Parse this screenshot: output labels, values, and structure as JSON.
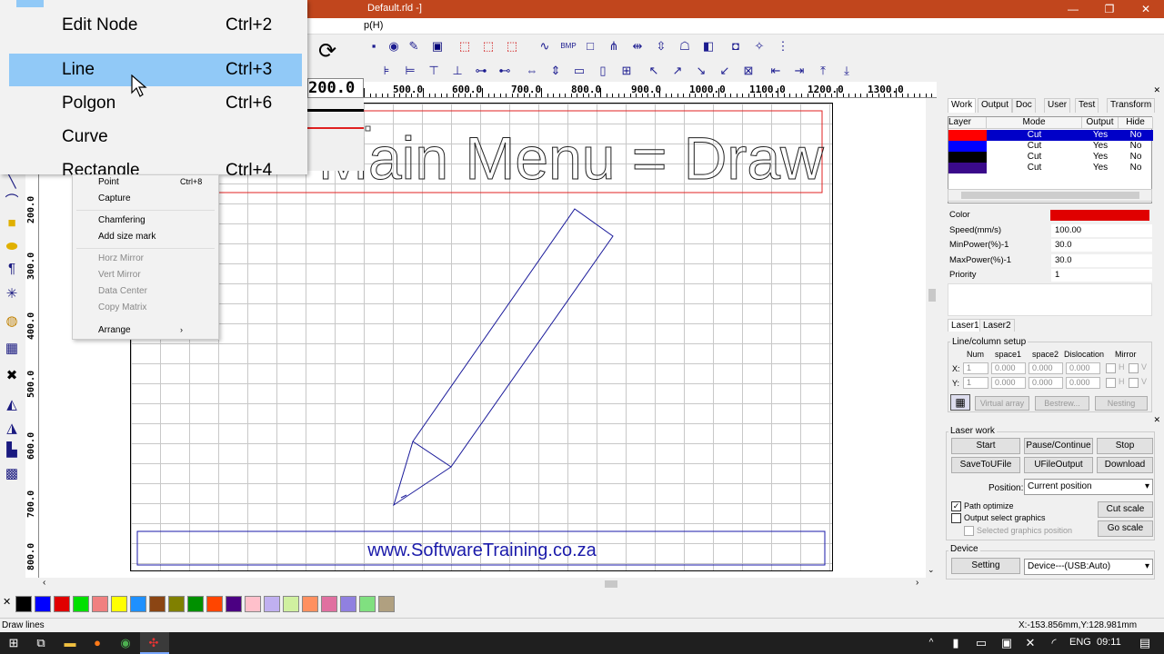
{
  "window": {
    "title": "Default.rld -]",
    "min": "—",
    "max": "❐",
    "close": "✕"
  },
  "menubar": {
    "visible_text": "p(H)"
  },
  "ruler_top_labels": [
    "500.0",
    "600.0",
    "700.0",
    "800.0",
    "900.0",
    "1000.0",
    "1100.0",
    "1200.0",
    "1300.0"
  ],
  "ruler_left_labels": [
    "200.0",
    "300.0",
    "400.0",
    "500.0",
    "600.0",
    "700.0",
    "800.0"
  ],
  "rotate_field": "200.0",
  "canvas": {
    "heading_text": "Main Menu = Draw",
    "watermark": "www.SoftwareTraining.co.za"
  },
  "draw_menu": {
    "items": [
      {
        "label": "Edit Node",
        "shortcut": "Ctrl+2"
      },
      {
        "label": "Line",
        "shortcut": "Ctrl+3",
        "highlighted": true
      },
      {
        "label": "Polgon",
        "shortcut": "Ctrl+6"
      },
      {
        "label": "Curve",
        "shortcut": ""
      },
      {
        "label": "Rectangle",
        "shortcut": "Ctrl+4"
      }
    ]
  },
  "context_menu": {
    "items": [
      {
        "label": "Point",
        "shortcut": "Ctrl+8",
        "enabled": true
      },
      {
        "label": "Capture",
        "shortcut": "",
        "enabled": true
      },
      {
        "label": "Chamfering",
        "shortcut": "",
        "enabled": true
      },
      {
        "label": "Add size mark",
        "shortcut": "",
        "enabled": true
      },
      {
        "label": "Horz Mirror",
        "shortcut": "",
        "enabled": false
      },
      {
        "label": "Vert Mirror",
        "shortcut": "",
        "enabled": false
      },
      {
        "label": "Data Center",
        "shortcut": "",
        "enabled": false
      },
      {
        "label": "Copy Matrix",
        "shortcut": "",
        "enabled": false
      },
      {
        "label": "Arrange",
        "shortcut": "›",
        "enabled": true
      }
    ]
  },
  "right_panel": {
    "tabs": [
      "Work",
      "Output",
      "Doc",
      "User",
      "Test",
      "Transform"
    ],
    "layer_table": {
      "headers": [
        "Layer",
        "Mode",
        "Output",
        "Hide"
      ],
      "rows": [
        {
          "color": "#ff0000",
          "mode": "Cut",
          "output": "Yes",
          "hide": "No",
          "selected": true
        },
        {
          "color": "#0000ff",
          "mode": "Cut",
          "output": "Yes",
          "hide": "No"
        },
        {
          "color": "#000000",
          "mode": "Cut",
          "output": "Yes",
          "hide": "No"
        },
        {
          "color": "#3a0a8a",
          "mode": "Cut",
          "output": "Yes",
          "hide": "No"
        }
      ]
    },
    "props": [
      {
        "key": "Color",
        "value": ""
      },
      {
        "key": "Speed(mm/s)",
        "value": "100.00"
      },
      {
        "key": "MinPower(%)-1",
        "value": "30.0"
      },
      {
        "key": "MaxPower(%)-1",
        "value": "30.0"
      },
      {
        "key": "Priority",
        "value": "1"
      }
    ],
    "color_value": "#e00000",
    "laser_tabs": [
      "Laser1",
      "Laser2"
    ],
    "array": {
      "title": "Line/column setup",
      "headers": [
        "Num",
        "space1",
        "space2",
        "Dislocation",
        "Mirror"
      ],
      "x_label": "X:",
      "y_label": "Y:",
      "x": [
        "1",
        "0.000",
        "0.000",
        "0.000"
      ],
      "y": [
        "1",
        "0.000",
        "0.000",
        "0.000"
      ],
      "mirror_h": "H",
      "mirror_v": "V",
      "virtual_array": "Virtual array",
      "bestrew": "Bestrew...",
      "nesting": "Nesting"
    }
  },
  "laser_work": {
    "title": "Laser work",
    "start": "Start",
    "pause": "Pause/Continue",
    "stop": "Stop",
    "save_to_ufile": "SaveToUFile",
    "ufile_output": "UFileOutput",
    "download": "Download",
    "position_label": "Position:",
    "position_value": "Current position",
    "path_optimize": "Path optimize",
    "output_select": "Output select graphics",
    "selected_position": "Selected graphics position",
    "cut_scale": "Cut scale",
    "go_scale": "Go scale"
  },
  "device": {
    "title": "Device",
    "setting": "Setting",
    "value": "Device---(USB:Auto)"
  },
  "palette": [
    "#000000",
    "#0000ff",
    "#e00000",
    "#00e000",
    "#f08080",
    "#ffff00",
    "#1e90ff",
    "#8b4513",
    "#808000",
    "#009000",
    "#ff4500",
    "#4b0082",
    "#ffc0cb",
    "#c0b0f0",
    "#d0f0a0",
    "#ff9060",
    "#e070a0",
    "#9080e0",
    "#80e080",
    "#b0a080"
  ],
  "status": {
    "left": "Draw lines",
    "coords": "X:-153.856mm,Y:128.981mm"
  },
  "taskbar": {
    "lang": "ENG",
    "time": "09:11"
  }
}
